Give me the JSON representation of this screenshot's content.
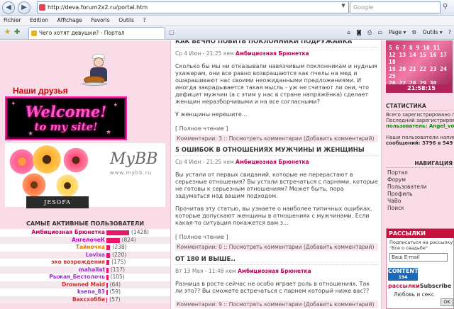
{
  "browser": {
    "url": "http://deva.forum2x2.ru/portal.htm",
    "search_placeholder": "Google",
    "menu": [
      "Fichier",
      "Edition",
      "Affichage",
      "Favoris",
      "Outils",
      "?"
    ],
    "tab_title": "Чего хотят девушки? - Портал",
    "tools": {
      "page": "Page",
      "outils": "Outils"
    }
  },
  "left": {
    "friends_title": "Наши друзья",
    "welcome_line1": "Welcome!",
    "welcome_line2": "to my site!",
    "mybb_logo": "MyBB",
    "mybb_url": "www.mybb.ru",
    "jesofa": "JESOFA",
    "users_title": "САМЫЕ АКТИВНЫЕ ПОЛЬЗОВАТЕЛИ",
    "users": [
      {
        "name": "Амбициозная Брюнетка",
        "count": "(1428)",
        "bar": 100,
        "color": "#c0005a"
      },
      {
        "name": "АнгелочеК",
        "count": "(824)",
        "bar": 58,
        "color": "#d000d0"
      },
      {
        "name": "Тайночка",
        "count": "(238)",
        "bar": 17,
        "color": "#e07a00"
      },
      {
        "name": "Lovixa",
        "count": "(220)",
        "bar": 16,
        "color": "#9a30d0"
      },
      {
        "name": "эко возрождения",
        "count": "(175)",
        "bar": 13,
        "color": "#d03030"
      },
      {
        "name": "mahallat",
        "count": "(117)",
        "bar": 9,
        "color": "#9a30d0"
      },
      {
        "name": "Рыжая_Бестолочь",
        "count": "(105)",
        "bar": 8,
        "color": "#9a30d0"
      },
      {
        "name": "Drowned Maid",
        "count": "(64)",
        "bar": 5,
        "color": "#d03030"
      },
      {
        "name": "ksena_83",
        "count": "(59)",
        "bar": 5,
        "color": "#9a30d0"
      },
      {
        "name": "Ваксхобби",
        "count": "(57)",
        "bar": 4,
        "color": "#d03030"
      }
    ]
  },
  "posts": [
    {
      "title": "КАК ВЕЧНО ПОБИТЬ ПОКЛОННИКИ ПОДРУЖАЙКА",
      "date": "Ср 4 Июн - 21:25 кем",
      "author": "Амбициозная Брюнетка",
      "body": "Сколько бы мы ни отказывали навязчивым поклонникам и нудным ухажерам, они все равно возвращаются как пчелы на мед и ошарашивают нас своими неожиданными предложениями. И иногда закрадывается такая мысль - уж не считают ли они, что дефицит мужчин (а с этим у нас в стране напряжёнка) сделает женщин неразборчивыми и на все согласными?",
      "body2": "У женщины нерешите...",
      "more": "[ Полное чтение ]",
      "comments_label": "Комментарии: 3 ::",
      "comments_link": "Посмотреть комментарии (Добавить комментарий)"
    },
    {
      "title": "5 ОШИБОК В ОТНОШЕНИЯХ МУЖЧИНЫ И ЖЕНЩИНЫ",
      "date": "Ср 4 Июн - 21:25 кем",
      "author": "Амбициозная Брюнетка",
      "body": "Вы устали от первых свиданий, которые не перерастают в серьезные отношения? Вы устали встречаться с парнями, которые не готовы к серьезным отношениям? Может быть, пора задуматься над вашим подходом.",
      "body2": "Прочитав эту статью, вы узнаете о наиболее типичных ошибках, которые допускают женщины в отношениях с мужчинами. Если какая-то ситуация покажется вам з...",
      "more": "[ Полное чтение ]",
      "comments_label": "Комментарии: 0 ::",
      "comments_link": "Посмотреть комментарии (Добавить комментарий)"
    },
    {
      "title": "ОТ 180 И ВЫШЕ..",
      "date": "Вт 13 Мая - 11:48 кем",
      "author": "Амбициозная Брюнетка",
      "body": "Разница в росте сейчас не особо играет роль в отношениях. Так ли это?? Вы сможете встречаться с парнем который ниже вас??",
      "body2": "",
      "more": "",
      "comments_label": "Комментарии: 9 ::",
      "comments_link": "Посмотреть комментарии (Добавить комментарий)"
    }
  ],
  "right": {
    "calendar_rows": [
      "5 6 7 8 9 10 11",
      "12 13 14 15 16 17 18",
      "19 20 21 22 23 24 25",
      "26 27 28 29 30"
    ],
    "clock": "21:58:15",
    "stats_title": "СТАТИСТИКА",
    "stats_lines": [
      "Всего зарегистрировано пользователей: 83",
      "Последний зарегистрированный",
      "пользователь: Angel_vo_",
      "",
      "Наши пользователи написали",
      "сообщений: 3796 в 549 с"
    ],
    "nav_title": "НАВИГАЦИЯ",
    "nav_items": [
      "Портал",
      "Форум",
      "Пользователи",
      "Профиль",
      "ЧаВо",
      "Поиск"
    ],
    "rss_title": "РАССЫЛКИ",
    "rss_text": "Подписаться на рассылку \"Все о свадьбе\"",
    "rss_email": "Ваш E-mail",
    "rss_content": "CONTENT",
    "rss_content_num": "194",
    "rss_sub": "рассылки",
    "rss_sub2": "Subscribe",
    "rss_love": "Любовь и секс",
    "rss_btn": "OK"
  }
}
